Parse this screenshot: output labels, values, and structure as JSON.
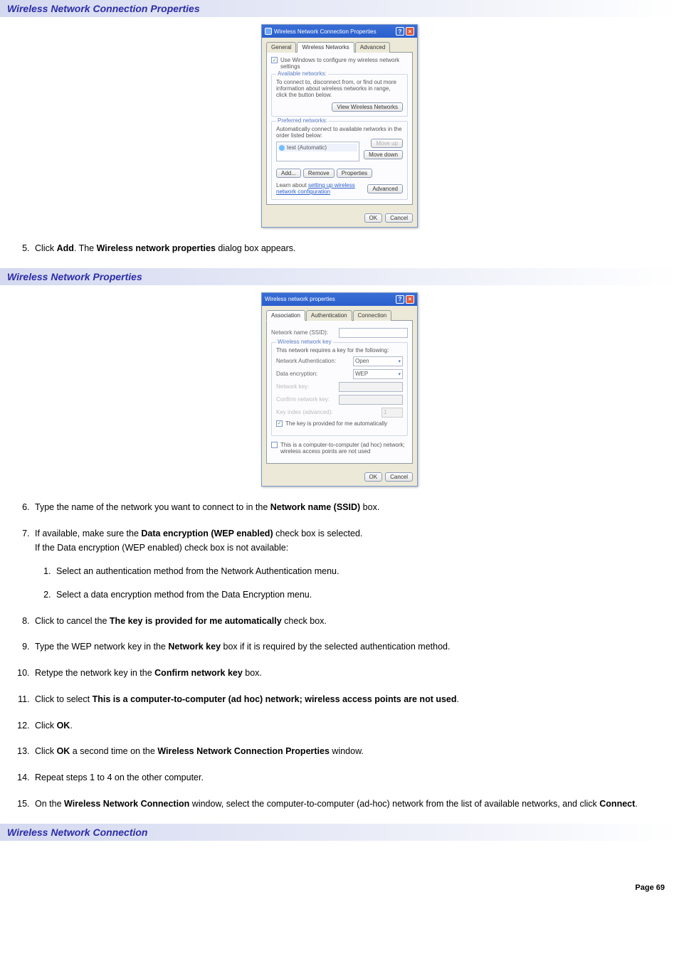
{
  "sections": {
    "header1": "Wireless Network Connection Properties",
    "header2": "Wireless Network Properties",
    "header3": "Wireless Network Connection"
  },
  "dialog1": {
    "title": "Wireless Network Connection Properties",
    "tabs": {
      "general": "General",
      "wireless": "Wireless Networks",
      "advanced": "Advanced"
    },
    "use_windows": "Use Windows to configure my wireless network settings",
    "available_title": "Available networks:",
    "available_text": "To connect to, disconnect from, or find out more information about wireless networks in range, click the button below.",
    "view_btn": "View Wireless Networks",
    "preferred_title": "Preferred networks:",
    "preferred_text": "Automatically connect to available networks in the order listed below:",
    "pref_item": "test (Automatic)",
    "moveup": "Move up",
    "movedown": "Move down",
    "add": "Add...",
    "remove": "Remove",
    "properties": "Properties",
    "learn1": "Learn about ",
    "learn_link": "setting up wireless network configuration",
    "advanced_btn": "Advanced",
    "ok": "OK",
    "cancel": "Cancel"
  },
  "dialog2": {
    "title": "Wireless network properties",
    "tabs": {
      "assoc": "Association",
      "auth": "Authentication",
      "conn": "Connection"
    },
    "ssid_label": "Network name (SSID):",
    "key_group_title": "Wireless network key",
    "key_group_text": "This network requires a key for the following:",
    "net_auth_label": "Network Authentication:",
    "net_auth_val": "Open",
    "data_enc_label": "Data encryption:",
    "data_enc_val": "WEP",
    "netkey_label": "Network key:",
    "confirm_label": "Confirm network key:",
    "keyindex_label": "Key index (advanced):",
    "keyindex_val": "1",
    "auto_key": "The key is provided for me automatically",
    "adhoc": "This is a computer-to-computer (ad hoc) network; wireless access points are not used",
    "ok": "OK",
    "cancel": "Cancel"
  },
  "steps": {
    "s5": {
      "pre": "Click ",
      "b1": "Add",
      "mid": ". The ",
      "b2": "Wireless network properties",
      "post": " dialog box appears."
    },
    "s6": {
      "pre": "Type the name of the network you want to connect to in the ",
      "b1": "Network name (SSID)",
      "post": " box."
    },
    "s7": {
      "pre": "If available, make sure the ",
      "b1": "Data encryption (WEP enabled)",
      "post": " check box is selected.",
      "note": "If the Data encryption (WEP enabled) check box is not available:",
      "sub1": "Select an authentication method from the Network Authentication menu.",
      "sub2": "Select a data encryption method from the Data Encryption menu."
    },
    "s8": {
      "pre": "Click to cancel the ",
      "b1": "The key is provided for me automatically",
      "post": " check box."
    },
    "s9": {
      "pre": "Type the WEP network key in the ",
      "b1": "Network key",
      "post": " box if it is required by the selected authentication method."
    },
    "s10": {
      "pre": "Retype the network key in the ",
      "b1": "Confirm network key",
      "post": " box."
    },
    "s11": {
      "pre": "Click to select ",
      "b1": "This is a computer-to-computer (ad hoc) network; wireless access points are not used",
      "post": "."
    },
    "s12": {
      "pre": "Click ",
      "b1": "OK",
      "post": "."
    },
    "s13": {
      "pre": "Click ",
      "b1": "OK",
      "mid": " a second time on the ",
      "b2": "Wireless Network Connection Properties",
      "post": " window."
    },
    "s14": {
      "text": "Repeat steps 1 to 4 on the other computer."
    },
    "s15": {
      "pre": "On the ",
      "b1": "Wireless Network Connection",
      "mid": " window, select the computer-to-computer (ad-hoc) network from the list of available networks, and click ",
      "b2": "Connect",
      "post": "."
    }
  },
  "footer": "Page 69"
}
